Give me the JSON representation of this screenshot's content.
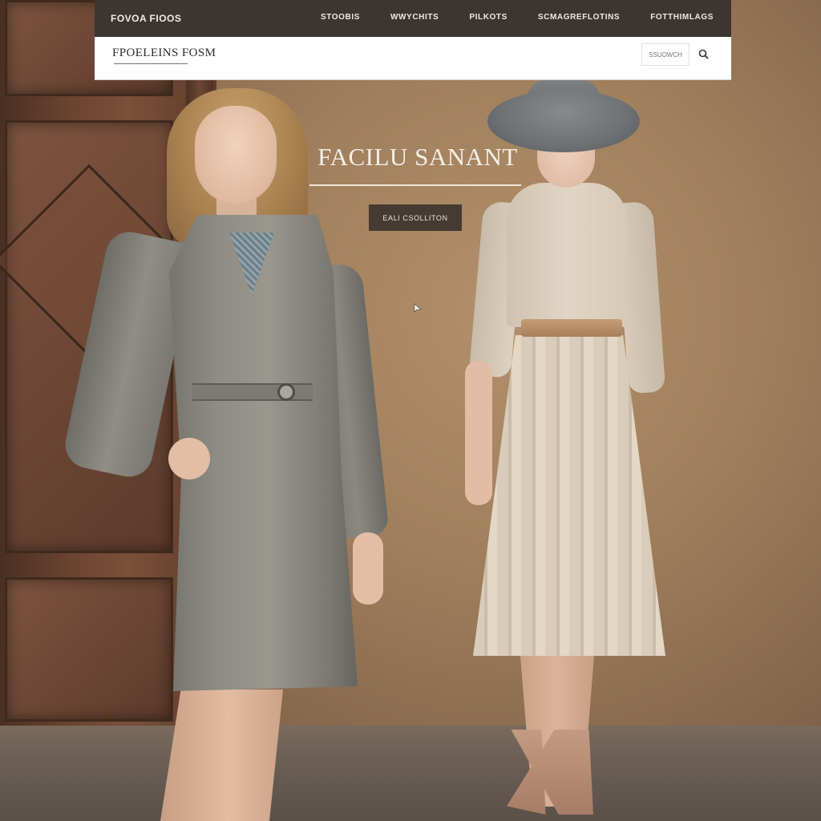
{
  "nav": {
    "brand": "FOVOA FIOOS",
    "links": [
      "STOOBIS",
      "WWYCHITS",
      "PILKOTS",
      "SCMAGREFLOTINS",
      "FOTTHIMLAGS"
    ]
  },
  "search": {
    "title": "FPOELEINS FOSM",
    "placeholder": "SSUOWCH"
  },
  "hero": {
    "title": "FACILU SANANT",
    "button_label": "EALI CSOLLITON"
  },
  "icons": {
    "search": "search-icon",
    "cursor": "cursor-icon"
  },
  "colors": {
    "nav_bg": "#3d3530",
    "search_bg": "#ffffff",
    "hero_button_bg": "#463b33",
    "hero_text": "#f4efe7"
  }
}
